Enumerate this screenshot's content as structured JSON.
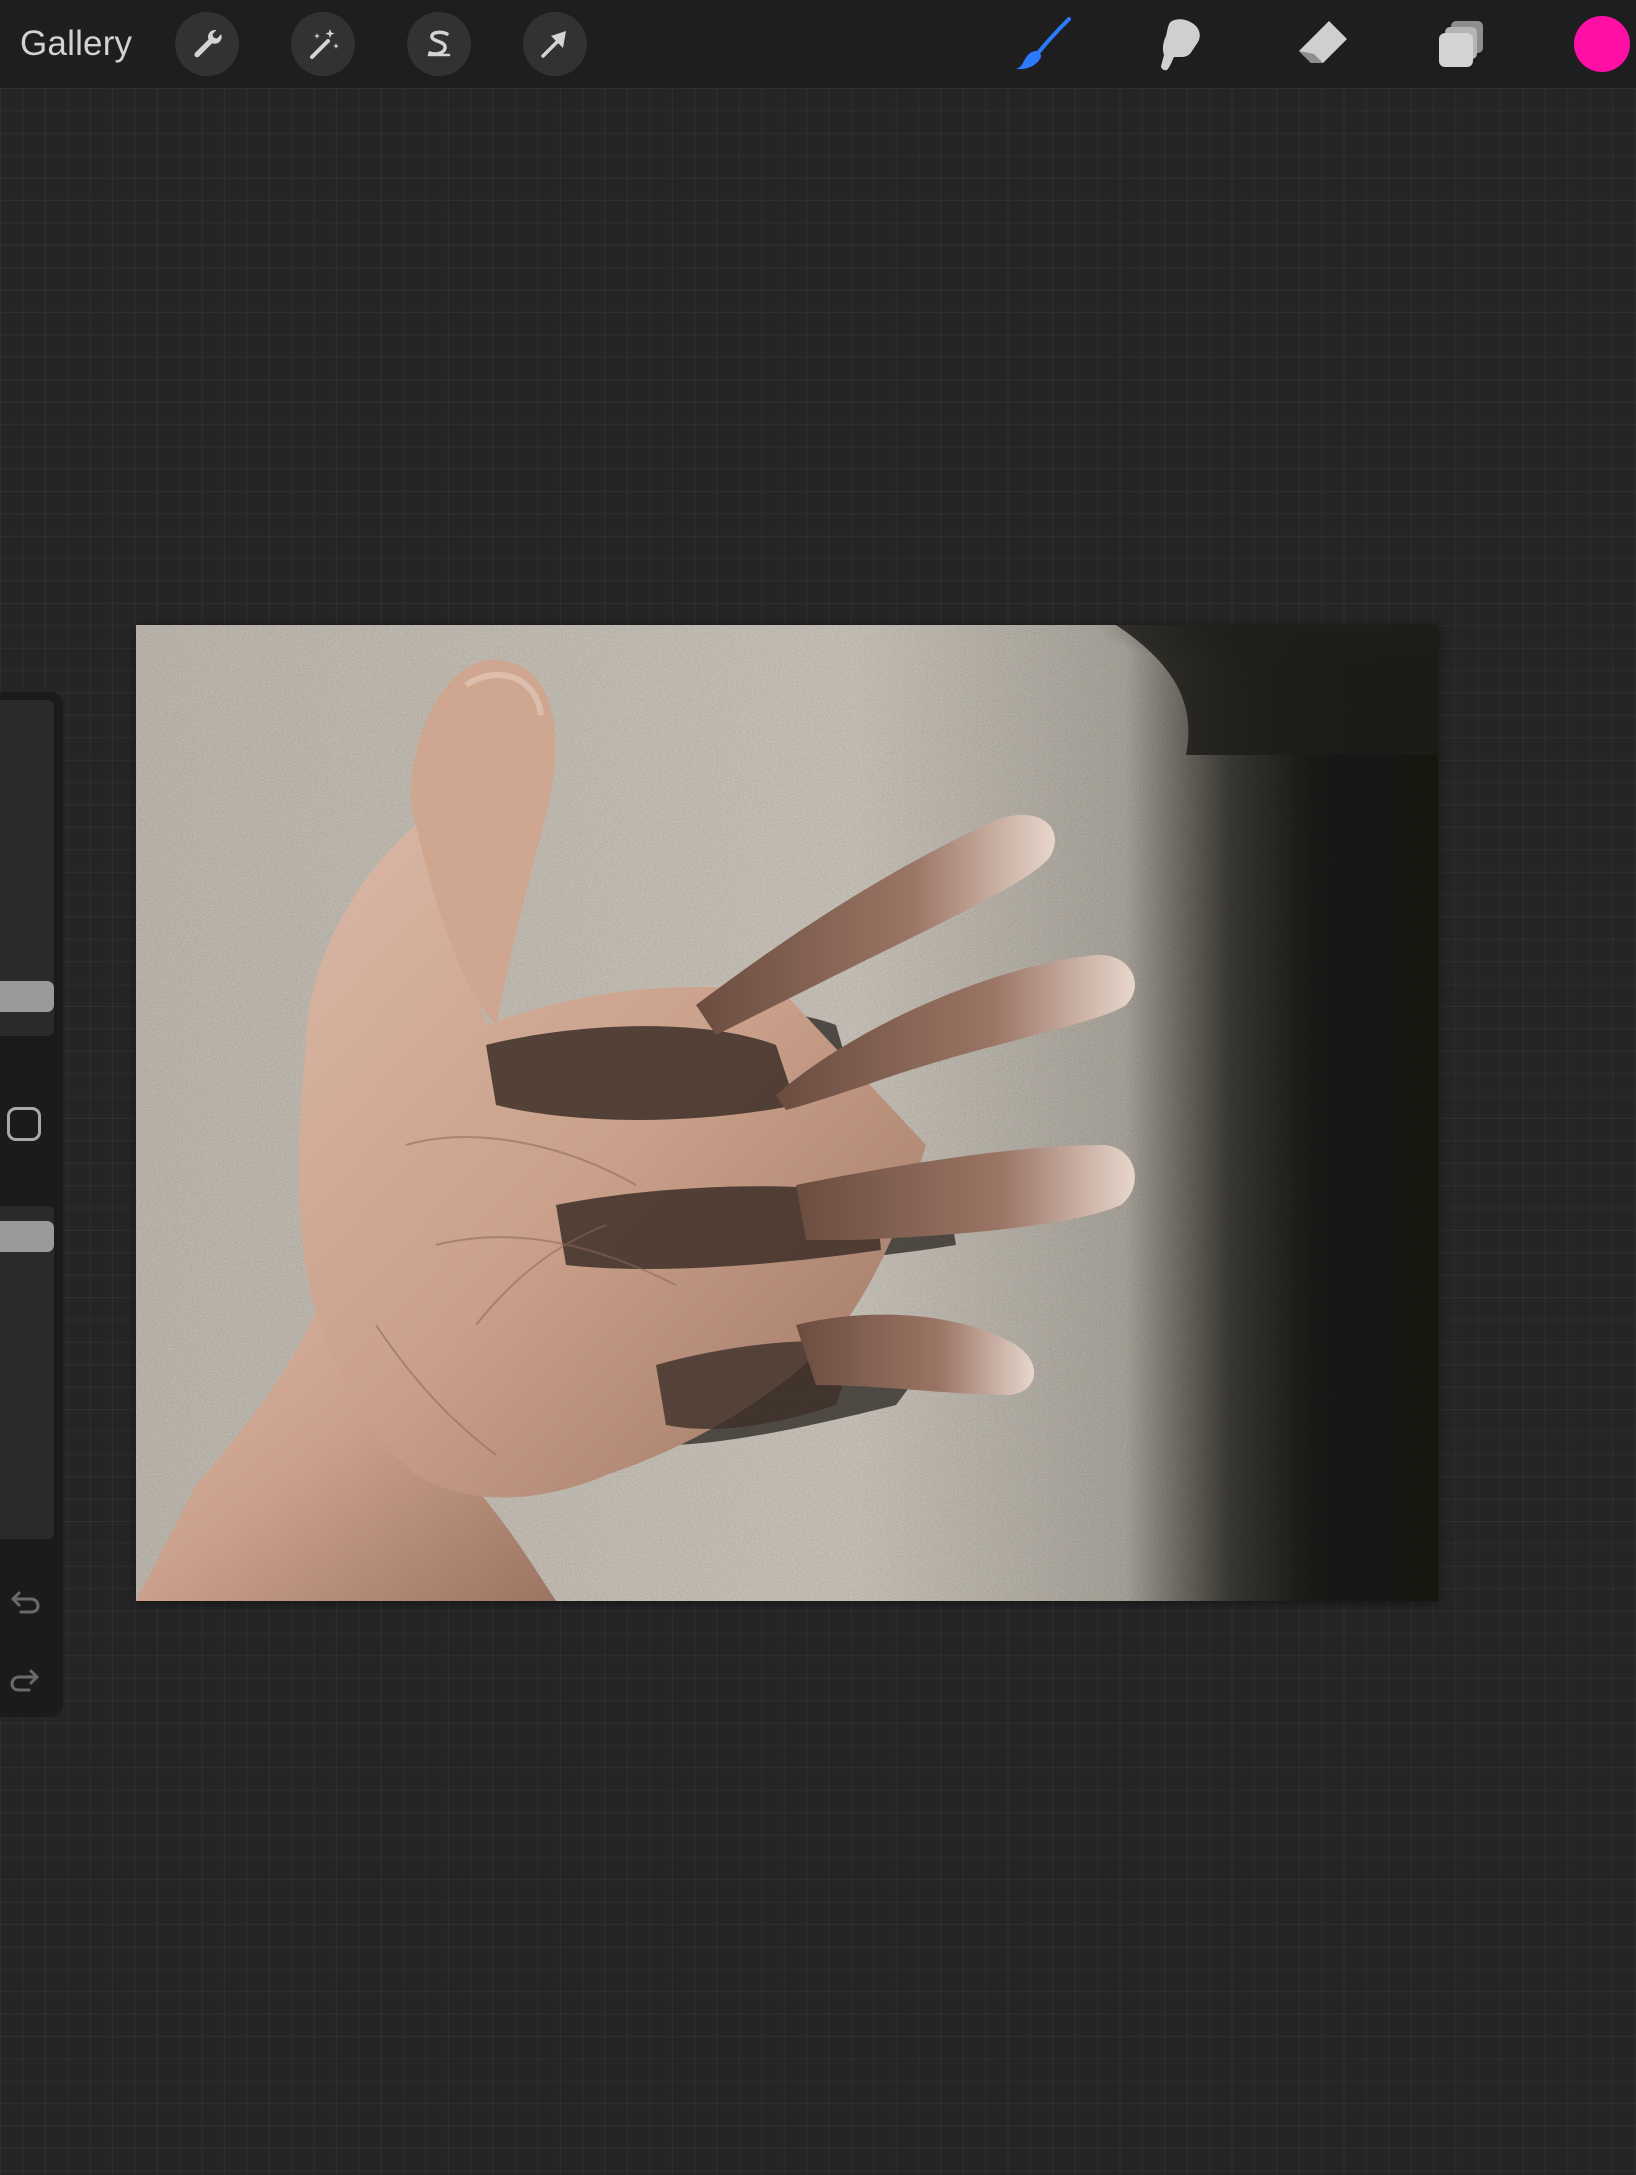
{
  "toolbar": {
    "gallery_label": "Gallery",
    "left_tools": [
      {
        "name": "actions",
        "icon": "wrench-icon"
      },
      {
        "name": "adjustments",
        "icon": "magic-wand-icon"
      },
      {
        "name": "selection",
        "icon": "selection-s-icon"
      },
      {
        "name": "transform",
        "icon": "arrow-cursor-icon"
      }
    ],
    "right_tools": [
      {
        "name": "brush",
        "icon": "brush-icon",
        "active": true
      },
      {
        "name": "smudge",
        "icon": "smudge-finger-icon",
        "active": false
      },
      {
        "name": "eraser",
        "icon": "eraser-icon",
        "active": false
      },
      {
        "name": "layers",
        "icon": "layers-icon",
        "active": false
      }
    ],
    "current_color": "#FF0FA6",
    "active_tool_color": "#2C7BFF"
  },
  "canvas": {
    "content": "photo-of-open-hand-with-shadow-on-carpet"
  },
  "sidebar": {
    "brush_size_level": 0.08,
    "brush_opacity_level": 0.95,
    "modify_button_icon": "square-outline-icon",
    "undo_icon": "undo-icon",
    "redo_icon": "redo-icon"
  }
}
